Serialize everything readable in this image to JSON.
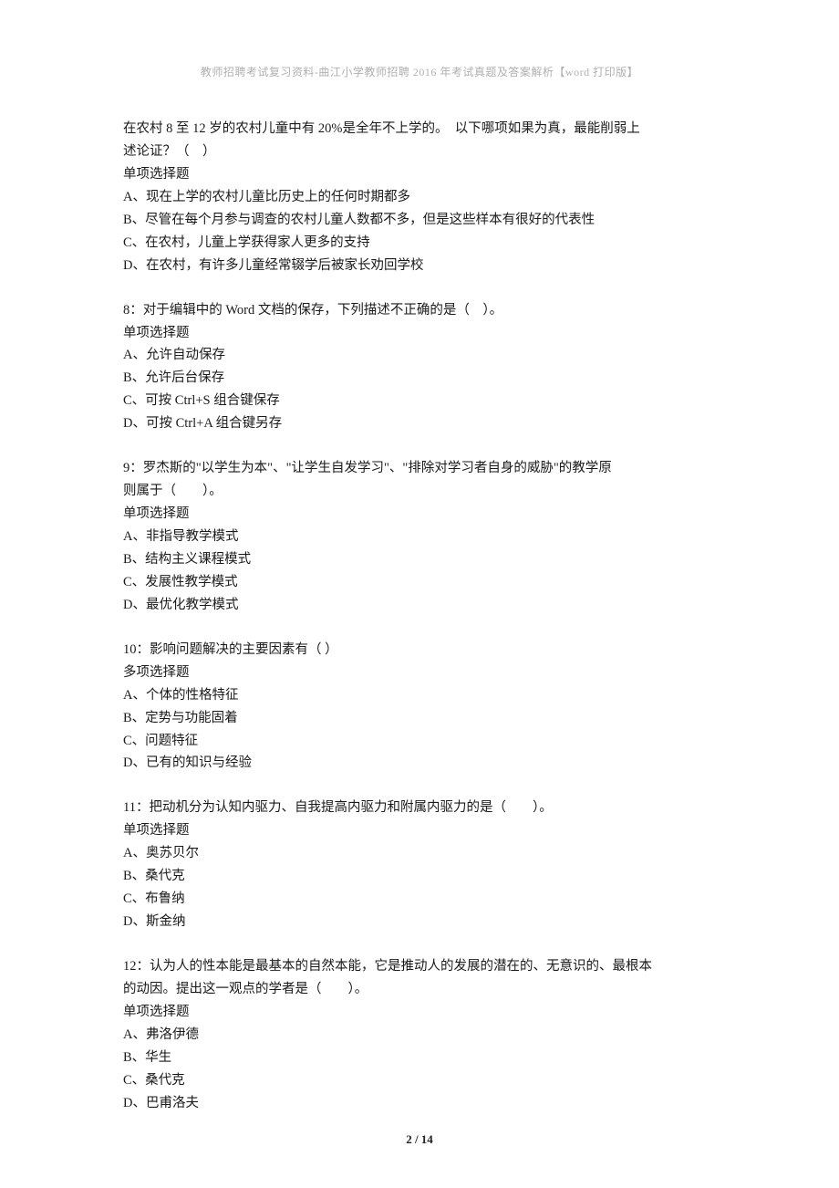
{
  "header": "教师招聘考试复习资料-曲江小学教师招聘 2016 年考试真题及答案解析【word 打印版】",
  "footer": "2 / 14",
  "questions": [
    {
      "stem_lines": [
        "在农村 8 至 12 岁的农村儿童中有 20%是全年不上学的。　以下哪项如果为真，最能削弱上",
        "述论证？（　）"
      ],
      "type": "单项选择题",
      "options": [
        "A、现在上学的农村儿童比历史上的任何时期都多",
        "B、尽管在每个月参与调查的农村儿童人数都不多，但是这些样本有很好的代表性",
        "C、在农村，儿童上学获得家人更多的支持",
        "D、在农村，有许多儿童经常辍学后被家长劝回学校"
      ]
    },
    {
      "stem_lines": [
        "8：对于编辑中的 Word 文档的保存，下列描述不正确的是（　）。"
      ],
      "type": "单项选择题",
      "options": [
        "A、允许自动保存",
        "B、允许后台保存",
        "C、可按 Ctrl+S 组合键保存",
        "D、可按 Ctrl+A 组合键另存"
      ]
    },
    {
      "stem_lines": [
        "9：罗杰斯的\"以学生为本\"、\"让学生自发学习\"、\"排除对学习者自身的威胁\"的教学原",
        "则属于（　　）。"
      ],
      "type": "单项选择题",
      "options": [
        "A、非指导教学模式",
        "B、结构主义课程模式",
        "C、发展性教学模式",
        "D、最优化教学模式"
      ]
    },
    {
      "stem_lines": [
        "10：影响问题解决的主要因素有（ ）"
      ],
      "type": "多项选择题",
      "options": [
        "A、个体的性格特征",
        "B、定势与功能固着",
        "C、问题特征",
        "D、已有的知识与经验"
      ]
    },
    {
      "stem_lines": [
        "11：把动机分为认知内驱力、自我提高内驱力和附属内驱力的是（　　）。"
      ],
      "type": "单项选择题",
      "options": [
        "A、奥苏贝尔",
        "B、桑代克",
        "C、布鲁纳",
        "D、斯金纳"
      ]
    },
    {
      "stem_lines": [
        "12：认为人的性本能是最基本的自然本能，它是推动人的发展的潜在的、无意识的、最根本",
        "的动因。提出这一观点的学者是（　　）。"
      ],
      "type": "单项选择题",
      "options": [
        "A、弗洛伊德",
        "B、华生",
        "C、桑代克",
        "D、巴甫洛夫"
      ]
    }
  ]
}
